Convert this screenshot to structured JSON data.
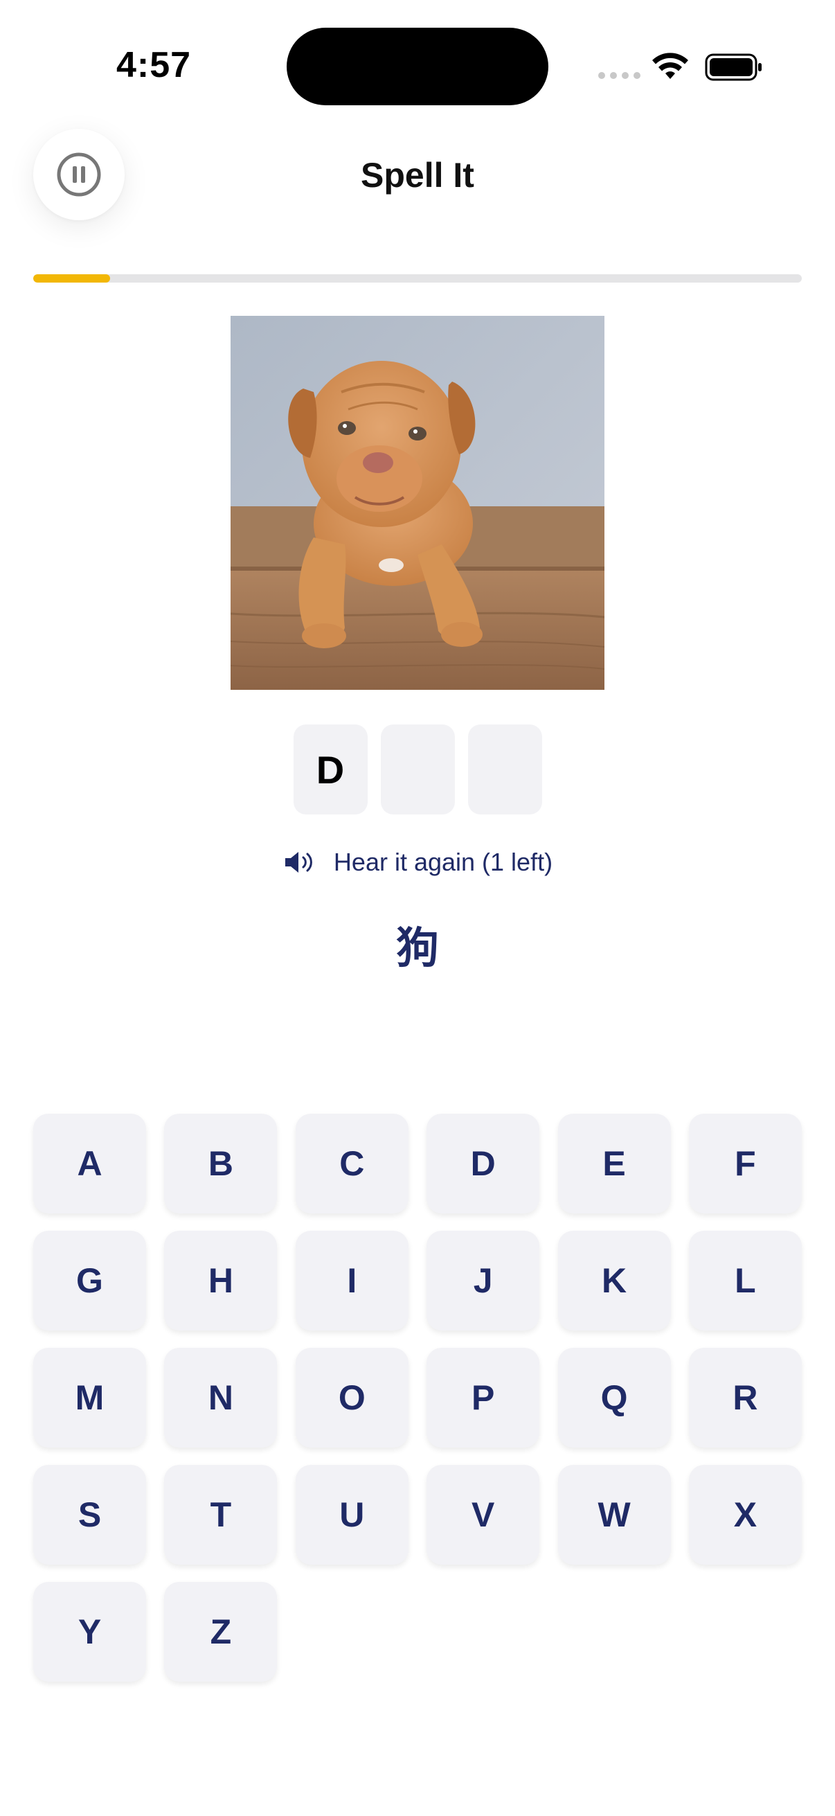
{
  "status_bar": {
    "time": "4:57"
  },
  "header": {
    "title": "Spell It",
    "pause_icon": "pause-icon"
  },
  "progress": {
    "fraction": 0.1,
    "color": "#f2b705"
  },
  "picture": {
    "subject_icon": "puppy-photo"
  },
  "answer": {
    "slots": [
      "D",
      "",
      ""
    ]
  },
  "hear_again": {
    "label": "Hear it again (1 left)",
    "icon": "speaker-icon"
  },
  "translation": "狗",
  "keyboard": {
    "keys": [
      "A",
      "B",
      "C",
      "D",
      "E",
      "F",
      "G",
      "H",
      "I",
      "J",
      "K",
      "L",
      "M",
      "N",
      "O",
      "P",
      "Q",
      "R",
      "S",
      "T",
      "U",
      "V",
      "W",
      "X",
      "Y",
      "Z"
    ]
  },
  "colors": {
    "accent": "#1f2a66",
    "progress": "#f2b705",
    "key_bg": "#f2f2f6"
  }
}
